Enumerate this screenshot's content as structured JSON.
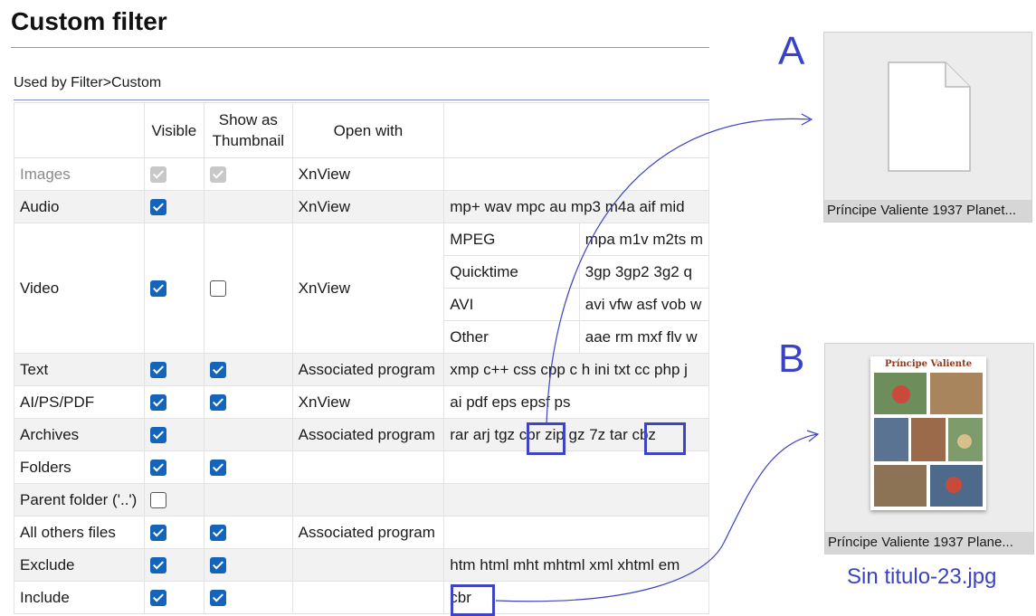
{
  "header": {
    "title": "Custom filter",
    "subtitle": "Used by Filter>Custom"
  },
  "columns": {
    "visible": "Visible",
    "thumb_line1": "Show as",
    "thumb_line2": "Thumbnail",
    "open_with": "Open with"
  },
  "rows": [
    {
      "name": "Images",
      "visible": "disabled",
      "thumbnail": "disabled",
      "open_with": "XnView",
      "extensions": ""
    },
    {
      "name": "Audio",
      "visible": "checked",
      "thumbnail": "none",
      "open_with": "XnView",
      "extensions": "mp+ wav mpc au mp3 m4a aif mid"
    },
    {
      "name": "Video",
      "visible": "checked",
      "thumbnail": "unchecked",
      "open_with": "XnView",
      "sub": [
        {
          "type": "MPEG",
          "extensions": "mpa m1v m2ts m"
        },
        {
          "type": "Quicktime",
          "extensions": "3gp 3gp2 3g2 q"
        },
        {
          "type": "AVI",
          "extensions": "avi vfw asf vob w"
        },
        {
          "type": "Other",
          "extensions": "aae rm mxf flv w"
        }
      ]
    },
    {
      "name": "Text",
      "visible": "checked",
      "thumbnail": "checked",
      "open_with": "Associated program",
      "extensions": "xmp c++ css cpp c h ini txt cc php j"
    },
    {
      "name": "AI/PS/PDF",
      "visible": "checked",
      "thumbnail": "checked",
      "open_with": "XnView",
      "extensions": "ai pdf eps epsf ps"
    },
    {
      "name": "Archives",
      "visible": "checked",
      "thumbnail": "none",
      "open_with": "Associated program",
      "extensions": "rar arj tgz cbr zip gz 7z tar cbz"
    },
    {
      "name": "Folders",
      "visible": "checked",
      "thumbnail": "checked",
      "open_with": "",
      "extensions": ""
    },
    {
      "name": "Parent folder ('..')",
      "visible": "unchecked",
      "thumbnail": "none",
      "open_with": "",
      "extensions": ""
    },
    {
      "name": "All others files",
      "visible": "checked",
      "thumbnail": "checked",
      "open_with": "Associated program",
      "extensions": ""
    },
    {
      "name": "Exclude",
      "visible": "checked",
      "thumbnail": "checked",
      "open_with": "",
      "extensions": "htm html mht mhtml xml xhtml em"
    },
    {
      "name": "Include",
      "visible": "checked",
      "thumbnail": "checked",
      "open_with": "",
      "extensions": "cbr"
    }
  ],
  "annotations": {
    "label_a": "A",
    "label_b": "B",
    "thumb_a_caption": "Príncipe Valiente 1937 Planet...",
    "thumb_b_caption": "Príncipe Valiente 1937 Plane...",
    "thumb_b_cover_title": "Príncipe Valiente",
    "filename": "Sin titulo-23.jpg",
    "accent_color": "#3a42c6",
    "highlighted_extensions": [
      "cbr",
      "cbz",
      "cbr"
    ]
  }
}
